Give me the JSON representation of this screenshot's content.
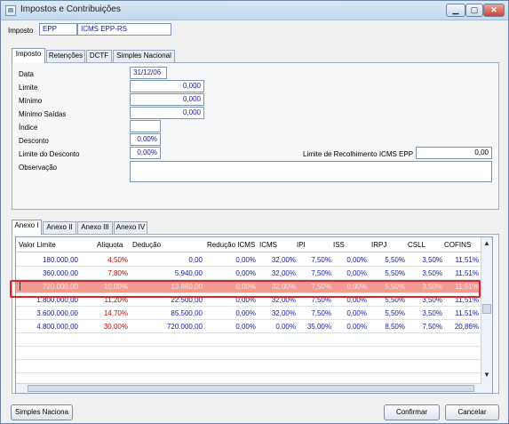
{
  "window": {
    "title": "Impostos e Contribuições"
  },
  "imposto": {
    "label": "Imposto",
    "code": "EPP",
    "name": "ICMS EPP-RS"
  },
  "top_tabs": [
    "Imposto",
    "Retenções",
    "DCTF",
    "Simples Nacional"
  ],
  "form": {
    "data": {
      "label": "Data",
      "value": "31/12/06"
    },
    "limite": {
      "label": "Limite",
      "value": "0,000"
    },
    "minimo": {
      "label": "Mínimo",
      "value": "0,000"
    },
    "minimo_saidas": {
      "label": "Mínimo Saídas",
      "value": "0,000"
    },
    "indice": {
      "label": "Índice",
      "value": ""
    },
    "desconto": {
      "label": "Desconto",
      "value": "0,00%"
    },
    "limite_desconto": {
      "label": "Limite do Desconto",
      "value": "0,00%"
    },
    "limite_recolhimento": {
      "label": "Limite de Recolhimento ICMS EPP",
      "value": "0,00"
    },
    "observacao": {
      "label": "Observação",
      "value": ""
    }
  },
  "annex_tabs": [
    "Anexo I",
    "Anexo II",
    "Anexo III",
    "Anexo IV"
  ],
  "grid": {
    "columns": [
      "Valor Limite",
      "Alíquota",
      "Dedução",
      "Redução ICMS",
      "ICMS",
      "IPI",
      "ISS",
      "IRPJ",
      "CSLL",
      "COFINS"
    ],
    "rows": [
      [
        "180.000,00",
        "4,50%",
        "0,00",
        "0,00%",
        "32,00%",
        "7,50%",
        "0,00%",
        "5,50%",
        "3,50%",
        "11,51%"
      ],
      [
        "360.000,00",
        "7,80%",
        "5.940,00",
        "0,00%",
        "32,00%",
        "7,50%",
        "0,00%",
        "5,50%",
        "3,50%",
        "11,51%"
      ],
      [
        "720.000,00",
        "10,00%",
        "13.860,00",
        "0,00%",
        "32,00%",
        "7,50%",
        "0,00%",
        "5,50%",
        "3,50%",
        "11,51%"
      ],
      [
        "1.800.000,00",
        "11,20%",
        "22.500,00",
        "0,00%",
        "32,00%",
        "7,50%",
        "0,00%",
        "5,50%",
        "3,50%",
        "11,51%"
      ],
      [
        "3.600.000,00",
        "14,70%",
        "85.500,00",
        "0,00%",
        "32,00%",
        "7,50%",
        "0,00%",
        "5,50%",
        "3,50%",
        "11,51%"
      ],
      [
        "4.800.000,00",
        "30,00%",
        "720.000,00",
        "0,00%",
        "0,00%",
        "35,00%",
        "0,00%",
        "8,50%",
        "7,50%",
        "20,86%"
      ]
    ],
    "selected_row": 2
  },
  "buttons": {
    "simples": "Simples Naciona",
    "confirmar": "Confirmar",
    "cancelar": "Cancelar"
  },
  "colors": {
    "aliquota": "#d40000",
    "values": "#1a1aa6",
    "highlight": "#e0222b"
  }
}
